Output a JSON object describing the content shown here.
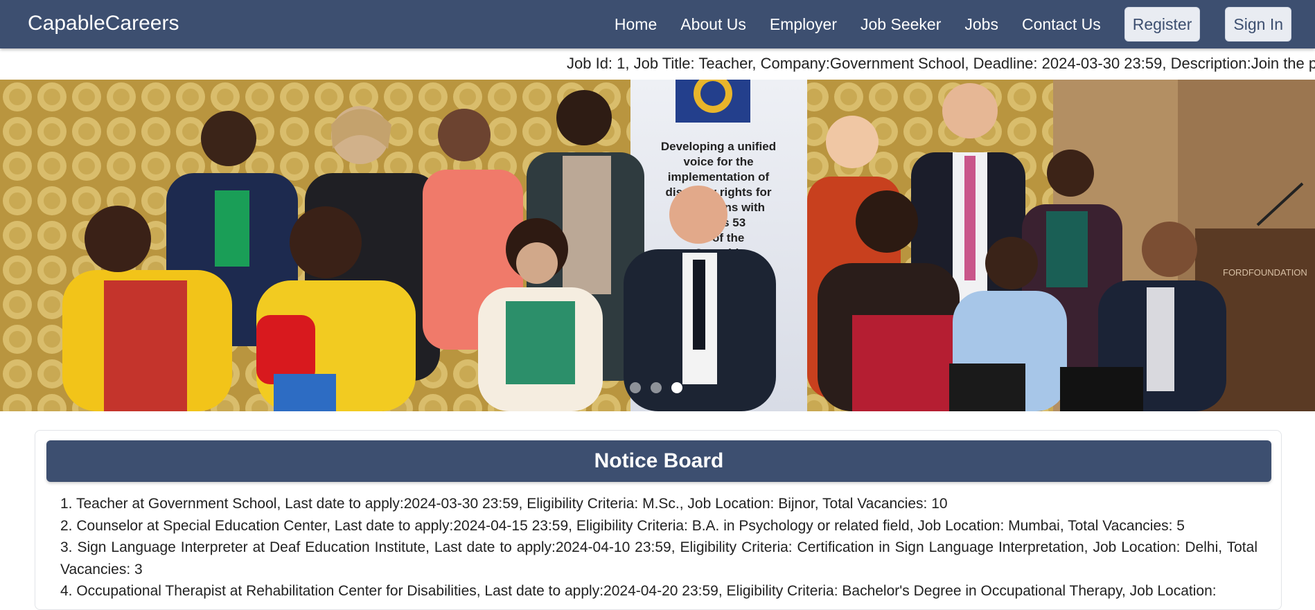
{
  "brand": "CapableCareers",
  "nav": {
    "links": [
      "Home",
      "About Us",
      "Employer",
      "Job Seeker",
      "Jobs",
      "Contact Us"
    ],
    "register": "Register",
    "signin": "Sign In"
  },
  "ticker": "Job Id: 1, Job Title: Teacher, Company:Government School, Deadline: 2024-03-30 23:59, Description:Join the p",
  "banner": {
    "sign_text": [
      "Developing a unified",
      "voice for the",
      "implementation of",
      "disability rights for",
      "PO  persons with",
      "across 53",
      "c   s of the",
      "C    wealth"
    ],
    "watermark": "FORDFOUNDATION",
    "slides": 3,
    "active_slide": 3
  },
  "notice_board": {
    "title": "Notice Board",
    "items": [
      "1. Teacher at Government School, Last date to apply:2024-03-30 23:59, Eligibility Criteria: M.Sc., Job Location: Bijnor, Total Vacancies: 10",
      "2. Counselor at Special Education Center, Last date to apply:2024-04-15 23:59, Eligibility Criteria: B.A. in Psychology or related field, Job Location: Mumbai, Total Vacancies: 5",
      "3. Sign Language Interpreter at Deaf Education Institute, Last date to apply:2024-04-10 23:59, Eligibility Criteria: Certification in Sign Language Interpretation, Job Location: Delhi, Total Vacancies: 3",
      "4. Occupational Therapist at Rehabilitation Center for Disabilities, Last date to apply:2024-04-20 23:59, Eligibility Criteria: Bachelor's Degree in Occupational Therapy, Job Location:"
    ]
  },
  "colors": {
    "primary": "#3d4f70",
    "button_bg": "#e9ecf2"
  }
}
